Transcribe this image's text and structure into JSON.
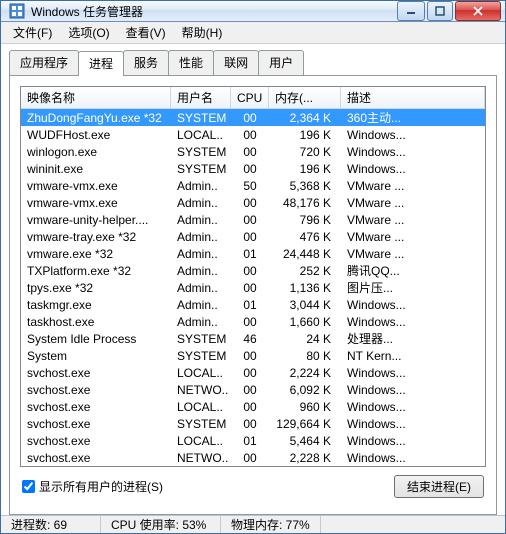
{
  "window": {
    "title": "Windows 任务管理器"
  },
  "menu": [
    "文件(F)",
    "选项(O)",
    "查看(V)",
    "帮助(H)"
  ],
  "tabs": [
    "应用程序",
    "进程",
    "服务",
    "性能",
    "联网",
    "用户"
  ],
  "active_tab": 1,
  "columns": [
    "映像名称",
    "用户名",
    "CPU",
    "内存(...",
    "描述"
  ],
  "processes": [
    {
      "name": "ZhuDongFangYu.exe *32",
      "user": "SYSTEM",
      "cpu": "00",
      "mem": "2,364 K",
      "desc": "360主动...",
      "selected": true
    },
    {
      "name": "WUDFHost.exe",
      "user": "LOCAL..",
      "cpu": "00",
      "mem": "196 K",
      "desc": "Windows..."
    },
    {
      "name": "winlogon.exe",
      "user": "SYSTEM",
      "cpu": "00",
      "mem": "720 K",
      "desc": "Windows..."
    },
    {
      "name": "wininit.exe",
      "user": "SYSTEM",
      "cpu": "00",
      "mem": "196 K",
      "desc": "Windows..."
    },
    {
      "name": "vmware-vmx.exe",
      "user": "Admin..",
      "cpu": "50",
      "mem": "5,368 K",
      "desc": "VMware ..."
    },
    {
      "name": "vmware-vmx.exe",
      "user": "Admin..",
      "cpu": "00",
      "mem": "48,176 K",
      "desc": "VMware ..."
    },
    {
      "name": "vmware-unity-helper....",
      "user": "Admin..",
      "cpu": "00",
      "mem": "796 K",
      "desc": "VMware ..."
    },
    {
      "name": "vmware-tray.exe *32",
      "user": "Admin..",
      "cpu": "00",
      "mem": "476 K",
      "desc": "VMware ..."
    },
    {
      "name": "vmware.exe *32",
      "user": "Admin..",
      "cpu": "01",
      "mem": "24,448 K",
      "desc": "VMware ..."
    },
    {
      "name": "TXPlatform.exe *32",
      "user": "Admin..",
      "cpu": "00",
      "mem": "252 K",
      "desc": "腾讯QQ..."
    },
    {
      "name": "tpys.exe *32",
      "user": "Admin..",
      "cpu": "00",
      "mem": "1,136 K",
      "desc": "图片压..."
    },
    {
      "name": "taskmgr.exe",
      "user": "Admin..",
      "cpu": "01",
      "mem": "3,044 K",
      "desc": "Windows..."
    },
    {
      "name": "taskhost.exe",
      "user": "Admin..",
      "cpu": "00",
      "mem": "1,660 K",
      "desc": "Windows..."
    },
    {
      "name": "System Idle Process",
      "user": "SYSTEM",
      "cpu": "46",
      "mem": "24 K",
      "desc": "处理器..."
    },
    {
      "name": "System",
      "user": "SYSTEM",
      "cpu": "00",
      "mem": "80 K",
      "desc": "NT Kern..."
    },
    {
      "name": "svchost.exe",
      "user": "LOCAL..",
      "cpu": "00",
      "mem": "2,224 K",
      "desc": "Windows..."
    },
    {
      "name": "svchost.exe",
      "user": "NETWO..",
      "cpu": "00",
      "mem": "6,092 K",
      "desc": "Windows..."
    },
    {
      "name": "svchost.exe",
      "user": "LOCAL..",
      "cpu": "00",
      "mem": "960 K",
      "desc": "Windows..."
    },
    {
      "name": "svchost.exe",
      "user": "SYSTEM",
      "cpu": "00",
      "mem": "129,664 K",
      "desc": "Windows..."
    },
    {
      "name": "svchost.exe",
      "user": "LOCAL..",
      "cpu": "01",
      "mem": "5,464 K",
      "desc": "Windows..."
    },
    {
      "name": "svchost.exe",
      "user": "NETWO..",
      "cpu": "00",
      "mem": "2,228 K",
      "desc": "Windows..."
    }
  ],
  "show_all_label": "显示所有用户的进程(S)",
  "show_all_checked": true,
  "end_process_label": "结束进程(E)",
  "status": {
    "processes": "进程数: 69",
    "cpu": "CPU 使用率: 53%",
    "mem": "物理内存: 77%"
  }
}
